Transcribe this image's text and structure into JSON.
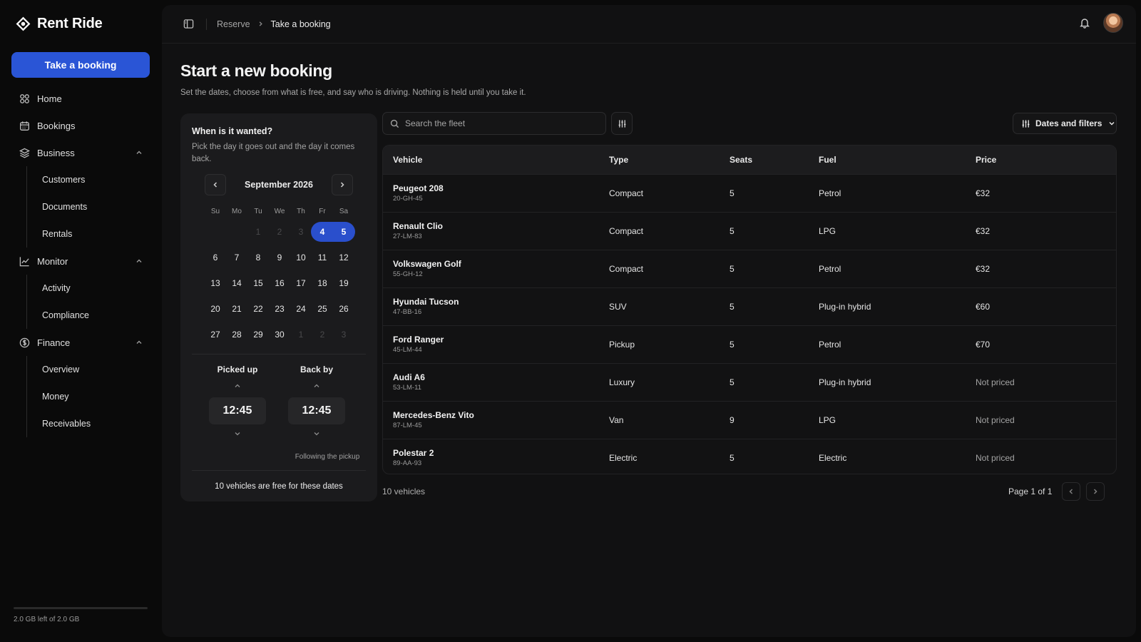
{
  "app": {
    "name": "Rent Ride",
    "cta_label": "Take a booking"
  },
  "sidebar": {
    "items": [
      {
        "label": "Home",
        "icon": "home-grid-icon"
      },
      {
        "label": "Bookings",
        "icon": "calendar-icon"
      },
      {
        "label": "Business",
        "icon": "layers-icon",
        "expanded": true,
        "children": [
          "Customers",
          "Documents",
          "Rentals"
        ]
      },
      {
        "label": "Monitor",
        "icon": "chart-line-icon",
        "expanded": true,
        "children": [
          "Activity",
          "Compliance"
        ]
      },
      {
        "label": "Finance",
        "icon": "dollar-circle-icon",
        "expanded": true,
        "children": [
          "Overview",
          "Money",
          "Receivables"
        ]
      }
    ],
    "storage": {
      "text": "2.0 GB left of 2.0 GB",
      "used_fraction": 0.0
    }
  },
  "breadcrumb": [
    "Reserve",
    "Take a booking"
  ],
  "page": {
    "title": "Start a new booking",
    "subtitle": "Set the dates, choose from what is free, and say who is driving. Nothing is held until you take it."
  },
  "calendar": {
    "question": "When is it wanted?",
    "hint": "Pick the day it goes out and the day it comes back.",
    "month": "September 2026",
    "weekdays": [
      "Su",
      "Mo",
      "Tu",
      "We",
      "Th",
      "Fr",
      "Sa"
    ],
    "weeks": [
      [
        {
          "d": "",
          "m": true
        },
        {
          "d": "",
          "m": true
        },
        {
          "d": "1",
          "m": true
        },
        {
          "d": "2",
          "m": true
        },
        {
          "d": "3",
          "m": true
        },
        {
          "d": "4",
          "s": true
        },
        {
          "d": "5",
          "s": true
        }
      ],
      [
        {
          "d": "6"
        },
        {
          "d": "7"
        },
        {
          "d": "8"
        },
        {
          "d": "9"
        },
        {
          "d": "10"
        },
        {
          "d": "11"
        },
        {
          "d": "12"
        }
      ],
      [
        {
          "d": "13"
        },
        {
          "d": "14"
        },
        {
          "d": "15"
        },
        {
          "d": "16"
        },
        {
          "d": "17"
        },
        {
          "d": "18"
        },
        {
          "d": "19"
        }
      ],
      [
        {
          "d": "20"
        },
        {
          "d": "21"
        },
        {
          "d": "22"
        },
        {
          "d": "23"
        },
        {
          "d": "24"
        },
        {
          "d": "25"
        },
        {
          "d": "26"
        }
      ],
      [
        {
          "d": "27"
        },
        {
          "d": "28"
        },
        {
          "d": "29"
        },
        {
          "d": "30"
        },
        {
          "d": "1",
          "m": true
        },
        {
          "d": "2",
          "m": true
        },
        {
          "d": "3",
          "m": true
        }
      ]
    ],
    "selected": {
      "start": "4",
      "end": "5"
    },
    "pickup_label": "Picked up",
    "pickup_time": "12:45",
    "return_label": "Back by",
    "return_time": "12:45",
    "return_note": "Following the pickup",
    "free_text": "10 vehicles are free for these dates"
  },
  "search": {
    "placeholder": "Search the fleet"
  },
  "filters_label": "Dates and filters",
  "table": {
    "columns": [
      "Vehicle",
      "Type",
      "Seats",
      "Fuel",
      "Price"
    ],
    "rows": [
      {
        "name": "Peugeot 208",
        "plate": "20-GH-45",
        "type": "Compact",
        "seats": "5",
        "fuel": "Petrol",
        "price": "€32"
      },
      {
        "name": "Renault Clio",
        "plate": "27-LM-83",
        "type": "Compact",
        "seats": "5",
        "fuel": "LPG",
        "price": "€32"
      },
      {
        "name": "Volkswagen Golf",
        "plate": "55-GH-12",
        "type": "Compact",
        "seats": "5",
        "fuel": "Petrol",
        "price": "€32"
      },
      {
        "name": "Hyundai Tucson",
        "plate": "47-BB-16",
        "type": "SUV",
        "seats": "5",
        "fuel": "Plug-in hybrid",
        "price": "€60"
      },
      {
        "name": "Ford Ranger",
        "plate": "45-LM-44",
        "type": "Pickup",
        "seats": "5",
        "fuel": "Petrol",
        "price": "€70"
      },
      {
        "name": "Audi A6",
        "plate": "53-LM-11",
        "type": "Luxury",
        "seats": "5",
        "fuel": "Plug-in hybrid",
        "price": "Not priced"
      },
      {
        "name": "Mercedes-Benz Vito",
        "plate": "87-LM-45",
        "type": "Van",
        "seats": "9",
        "fuel": "LPG",
        "price": "Not priced"
      },
      {
        "name": "Polestar 2",
        "plate": "89-AA-93",
        "type": "Electric",
        "seats": "5",
        "fuel": "Electric",
        "price": "Not priced"
      }
    ],
    "count_text": "10 vehicles",
    "page_text": "Page 1 of 1"
  },
  "colors": {
    "accent": "#2a55d6",
    "background": "#0a0a0a",
    "panel": "#111112"
  }
}
